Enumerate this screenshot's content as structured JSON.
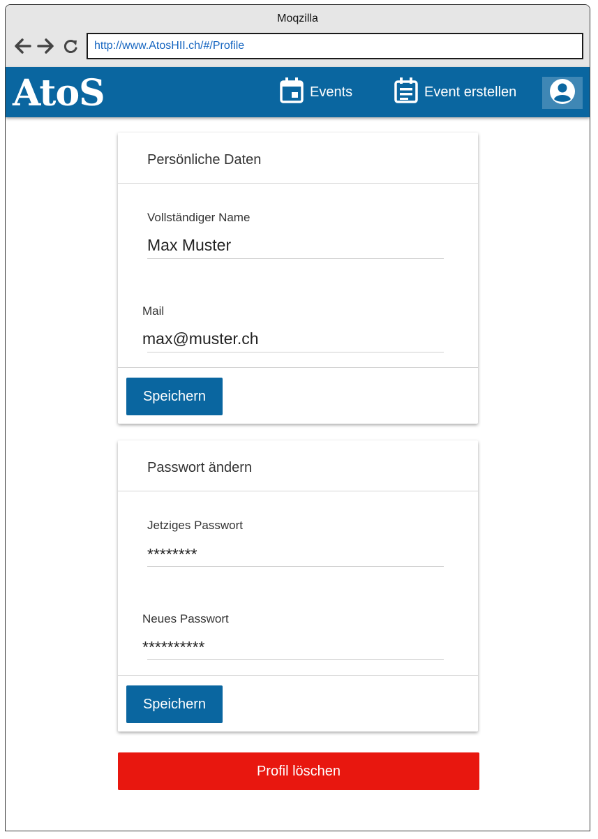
{
  "window": {
    "title": "Moqzilla"
  },
  "browser": {
    "url": "http://www.AtosHII.ch/#/Profile"
  },
  "header": {
    "logo": "AtoS",
    "nav": [
      {
        "label": "Events",
        "icon": "calendar-icon"
      },
      {
        "label": "Event erstellen",
        "icon": "event-create-icon"
      }
    ],
    "profile_icon": "account-circle-icon"
  },
  "personal_card": {
    "title": "Persönliche Daten",
    "name_label": "Vollständiger Name",
    "name_value": "Max Muster",
    "mail_label": "Mail",
    "mail_value": "max@muster.ch",
    "save_label": "Speichern"
  },
  "password_card": {
    "title": "Passwort ändern",
    "current_label": "Jetziges Passwort",
    "current_value": "********",
    "new_label": "Neues Passwort",
    "new_value": "**********",
    "save_label": "Speichern"
  },
  "delete_button": {
    "label": "Profil löschen"
  },
  "colors": {
    "primary": "#0a66a0",
    "danger": "#e8170f",
    "url_text": "#1565c0"
  }
}
